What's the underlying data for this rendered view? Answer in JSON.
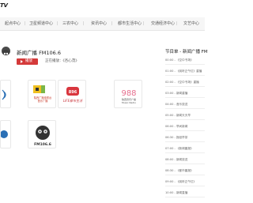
{
  "logo": {
    "text": "TV"
  },
  "nav": {
    "items": [
      "起点中心",
      "卫星频道中心",
      "三农中心",
      "资讯中心",
      "都市生活中心",
      "交通经济中心",
      "文艺中心"
    ]
  },
  "station": {
    "name": "新闻广播 FM106.6"
  },
  "player": {
    "play_label": "播放",
    "now_playing": "正在播放：《",
    "now_playing_title": "杏心茂",
    "now_playing_end": "》"
  },
  "cards": [
    {
      "id": "card-1"
    },
    {
      "id": "card-2",
      "text": "陕西广播电视台\n音乐广播"
    },
    {
      "id": "card-3",
      "text": "LIFE 都市生活广播"
    },
    {
      "id": "card-4",
      "big": "988",
      "text": "陕西音乐广播\nMusic Radio"
    },
    {
      "id": "card-5"
    },
    {
      "id": "card-6",
      "text": "FM106.6"
    }
  ],
  "schedule": {
    "title": "节目单 - 新闻广播 FM",
    "items": [
      "00:00 - 《空中书场》",
      "01:00 - 《阅听正午红》重播",
      "02:00 - 《空中书场》重播",
      "03:00 - 新闻重播",
      "04:00 - 音乐放送",
      "05:00 - 新闻天天早",
      "06:00 - 早间新闻",
      "06:30 - 报纸早茶",
      "07:00 - 《新闻晨报》",
      "08:00 - 新闻放送",
      "08:30 - 《都市晨报》",
      "09:00 - 《阅听正午红》",
      "10:00 - 新闻直播",
      "11:00 - 新闻之窗",
      "12:00 - 《午间新闻》"
    ]
  },
  "colors": {
    "accent": "#d43a3a",
    "nav_bg": "#f6f6f6"
  }
}
